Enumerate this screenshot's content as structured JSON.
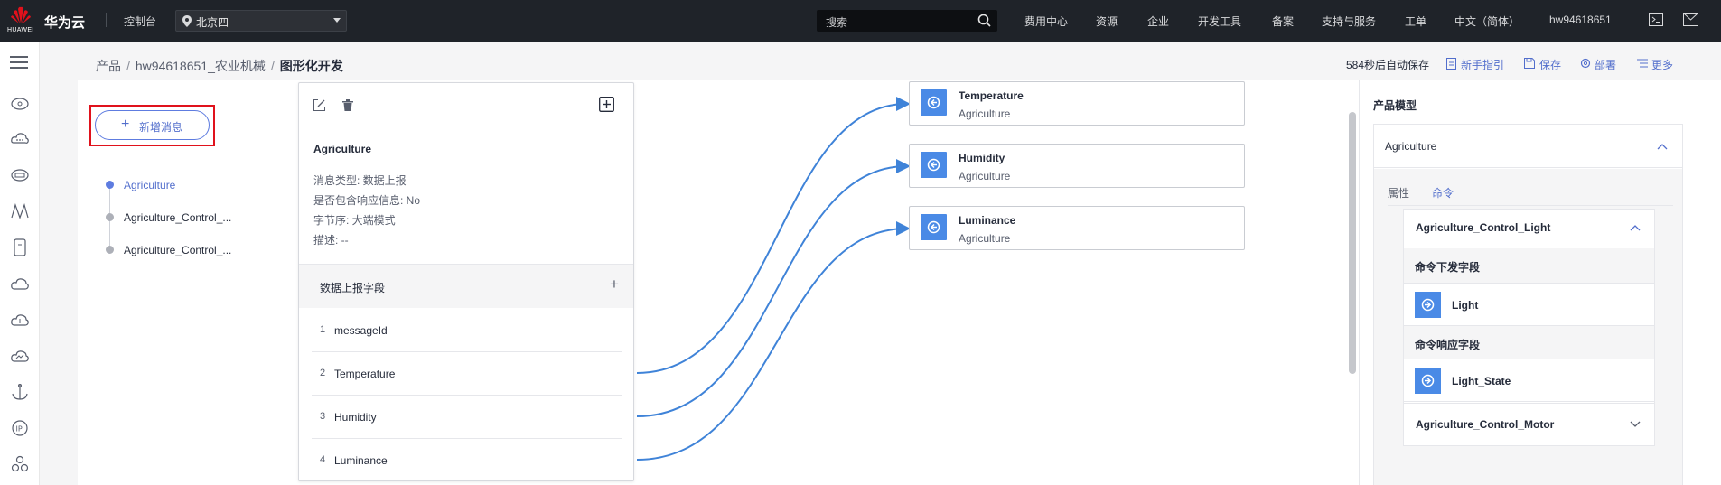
{
  "topbar": {
    "brand": "华为云",
    "logo_text": "HUAWEI",
    "console": "控制台",
    "region": "北京四",
    "search_placeholder": "搜索",
    "nav": [
      "费用中心",
      "资源",
      "企业",
      "开发工具",
      "备案",
      "支持与服务",
      "工单",
      "中文（简体）",
      "hw94618651"
    ]
  },
  "breadcrumb": {
    "items": [
      "产品",
      "hw94618651_农业机械"
    ],
    "current": "图形化开发"
  },
  "toolbar": {
    "autosave": "584秒后自动保存",
    "guide": "新手指引",
    "save": "保存",
    "deploy": "部署",
    "more": "更多"
  },
  "messages": {
    "add_label": "新增消息",
    "items": [
      "Agriculture",
      "Agriculture_Control_...",
      "Agriculture_Control_..."
    ]
  },
  "card": {
    "title": "Agriculture",
    "meta": [
      "消息类型: 数据上报",
      "是否包含响应信息: No",
      "字节序: 大端模式",
      "描述: --"
    ],
    "fields_header": "数据上报字段",
    "fields": [
      {
        "n": "1",
        "v": "messageId"
      },
      {
        "n": "2",
        "v": "Temperature"
      },
      {
        "n": "3",
        "v": "Humidity"
      },
      {
        "n": "4",
        "v": "Luminance"
      }
    ]
  },
  "nodes": [
    {
      "title": "Temperature",
      "sub": "Agriculture"
    },
    {
      "title": "Humidity",
      "sub": "Agriculture"
    },
    {
      "title": "Luminance",
      "sub": "Agriculture"
    }
  ],
  "model": {
    "title": "产品模型",
    "service": "Agriculture",
    "tabs": [
      "属性",
      "命令"
    ],
    "commands": [
      {
        "name": "Agriculture_Control_Light",
        "down_label": "命令下发字段",
        "down_field": "Light",
        "resp_label": "命令响应字段",
        "resp_field": "Light_State"
      },
      {
        "name": "Agriculture_Control_Motor"
      }
    ]
  },
  "colors": {
    "accent": "#526ecc",
    "highlight": "#e0121c",
    "node_icon": "#4a8ae6",
    "curve": "#3f83d8"
  }
}
